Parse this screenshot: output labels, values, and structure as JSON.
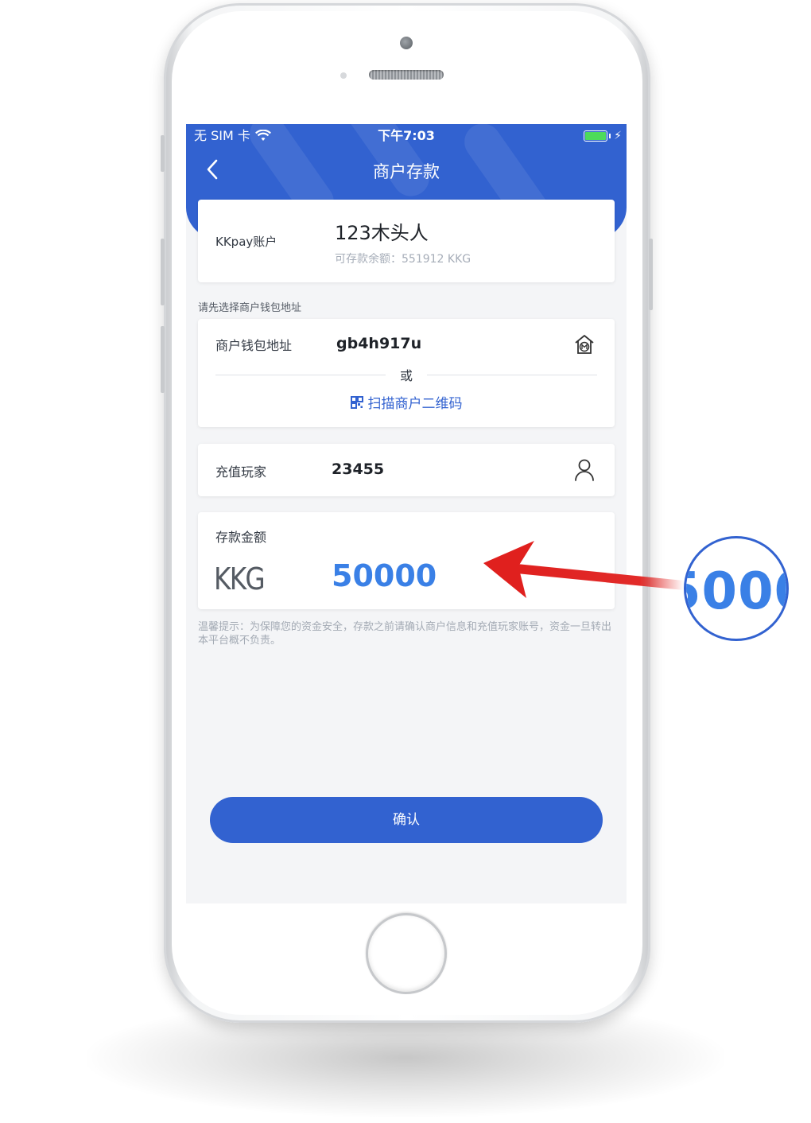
{
  "status_bar": {
    "carrier": "无 SIM 卡",
    "time": "下午7:03",
    "wifi_icon": "wifi-icon",
    "battery_icon": "battery-icon"
  },
  "nav": {
    "title": "商户存款",
    "back_icon": "chevron-left-icon"
  },
  "account": {
    "label": "KKpay账户",
    "name": "123木头人",
    "balance": "可存款余额：551912 KKG"
  },
  "wallet": {
    "section_hint": "请先选择商户钱包地址",
    "label": "商户钱包地址",
    "value": "gb4h917u",
    "icon": "merchant-store-icon",
    "or_text": "或",
    "scan_label": "扫描商户二维码",
    "scan_icon": "qr-code-icon"
  },
  "player": {
    "label": "充值玩家",
    "value": "23455",
    "icon": "user-icon"
  },
  "amount": {
    "label": "存款金额",
    "currency": "KKG",
    "value": "50000"
  },
  "tip": "温馨提示：为保障您的资金安全，存款之前请确认商户信息和充值玩家账号，资金一旦转出本平台概不负责。",
  "confirm_label": "确认",
  "zoom_callout": {
    "text": "5000"
  },
  "colors": {
    "brand_blue": "#3262d0",
    "amount_blue": "#3a80e6",
    "arrow_red": "#e0201e",
    "background": "#f4f5f7"
  }
}
